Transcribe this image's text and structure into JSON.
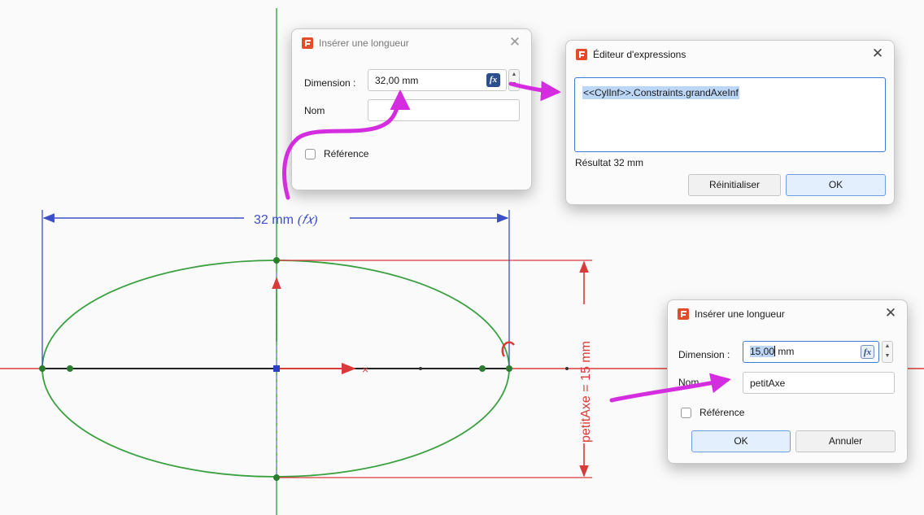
{
  "sketch": {
    "horizontal_dimension": "32 mm",
    "horizontal_dimension_fx": "(𝑓𝑥)",
    "vertical_dimension": "petitAxe = 15 mm",
    "x_axis_marker": "×"
  },
  "dialog_top_left": {
    "title": "Insérer une longueur",
    "dimension_label": "Dimension :",
    "dimension_value": "32,00 mm",
    "name_label": "Nom",
    "name_value": "",
    "reference_label": "Référence",
    "fx_label": "fx"
  },
  "expression_editor": {
    "title": "Éditeur d'expressions",
    "expression": "<<CylInf>>.Constraints.grandAxeInf",
    "result_text": "Résultat 32 mm",
    "reset_label": "Réinitialiser",
    "ok_label": "OK"
  },
  "dialog_bottom_right": {
    "title": "Insérer une longueur",
    "dimension_label": "Dimension :",
    "dimension_value_selected": "15,00",
    "dimension_value_rest": " mm",
    "name_label": "Nom",
    "name_value": "petitAxe",
    "reference_label": "Référence",
    "ok_label": "OK",
    "cancel_label": "Annuler",
    "fx_label": "fx"
  },
  "colors": {
    "sketch_green": "#3aa040",
    "dimension_blue": "#3c4fc7",
    "constraint_red": "#d93a3a",
    "annotation_magenta": "#d42de0",
    "selection_blue": "#bcd6f6"
  }
}
